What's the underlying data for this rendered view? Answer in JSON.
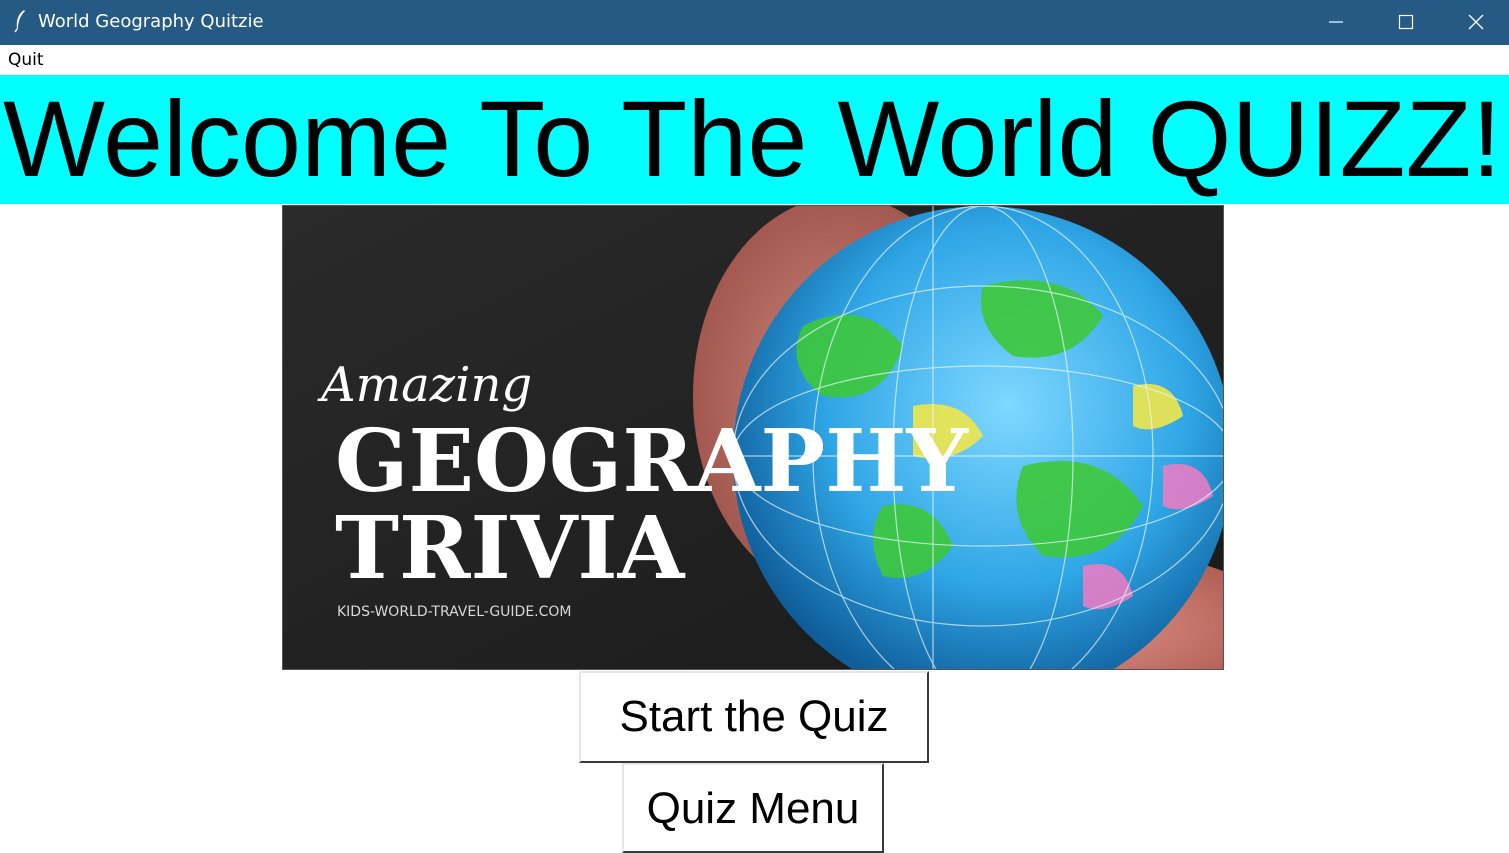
{
  "window": {
    "title": "World Geography Quitzie",
    "icon": "feather-icon",
    "controls": [
      "minimize-icon",
      "maximize-icon",
      "close-icon"
    ],
    "titlebar_color": "#245a83"
  },
  "menubar": {
    "quit_label": "Quit"
  },
  "banner": {
    "heading": "Welcome To The World QUIZZ!",
    "background": "#00ffff"
  },
  "image": {
    "script_word": "Amazing",
    "line1": "GEOGRAPHY",
    "line2": "TRIVIA",
    "credit": "KIDS-WORLD-TRAVEL-GUIDE.COM"
  },
  "buttons": {
    "start_label": "Start the Quiz",
    "menu_label": "Quiz Menu"
  }
}
